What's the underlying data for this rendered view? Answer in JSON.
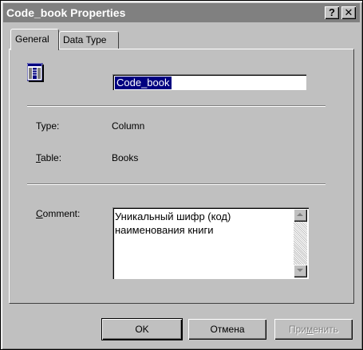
{
  "window": {
    "title": "Code_book Properties",
    "help_glyph": "?",
    "close_glyph": "✕"
  },
  "tabs": [
    {
      "label": "General",
      "active": true
    },
    {
      "label": "Data Type",
      "active": false
    }
  ],
  "general": {
    "icon": "column-icon",
    "name_value": "Code_book",
    "type_label_mnemonic": "",
    "type_label": "Type:",
    "type_value": "Column",
    "table_label_first": "T",
    "table_label_rest": "able:",
    "table_value": "Books",
    "comment_label_first": "C",
    "comment_label_rest": "omment:",
    "comment_lines": [
      "Уникальный шифр (код)",
      "наименования книги"
    ]
  },
  "buttons": {
    "ok": "OK",
    "cancel": "Отмена",
    "apply_before": "При",
    "apply_mnemonic": "м",
    "apply_after": "енить",
    "apply_enabled": false
  },
  "colors": {
    "face": "#c0c0c0",
    "title_bar": "#808080",
    "selection": "#000080"
  }
}
